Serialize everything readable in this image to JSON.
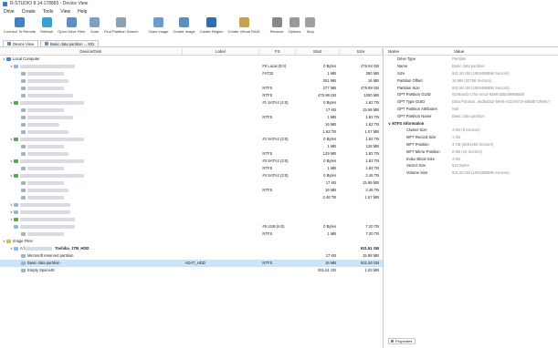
{
  "window": {
    "title": "R-STUDIO 8.14.178865 - Device View"
  },
  "menu": [
    "Drive",
    "Create",
    "Tools",
    "View",
    "Help"
  ],
  "toolbar": [
    {
      "label": "Connect To Remote",
      "icon": "connect-icon",
      "color": "#4a7fc4"
    },
    {
      "label": "Refresh",
      "icon": "refresh-icon",
      "color": "#3aa0d8"
    },
    {
      "label": "Open Drive Files",
      "icon": "open-files-icon",
      "color": "#5a8fcf"
    },
    {
      "label": "Scan",
      "icon": "scan-icon",
      "color": "#7aa2c8"
    },
    {
      "label": "Find Partition Search",
      "icon": "find-partition-icon",
      "color": "#8aa0b8"
    },
    {
      "label": "Open Image",
      "icon": "open-image-icon",
      "color": "#6a9ccf"
    },
    {
      "label": "Create Image",
      "icon": "create-image-icon",
      "color": "#5c8fbf"
    },
    {
      "label": "Create Region",
      "icon": "create-region-icon",
      "color": "#2f6db0"
    },
    {
      "label": "Create Virtual RAID",
      "icon": "virtual-raid-icon",
      "color": "#c7a24a"
    },
    {
      "label": "Remove",
      "icon": "remove-icon",
      "color": "#888888"
    },
    {
      "label": "Options",
      "icon": "options-icon",
      "color": "#9a9a9a"
    },
    {
      "label": "Stop",
      "icon": "stop-icon",
      "color": "#a0a0a0"
    }
  ],
  "tabs": [
    {
      "label": "Device View",
      "active": true
    },
    {
      "label": "Basic data partition ... 931",
      "active": false
    }
  ],
  "columns": {
    "device": "Device/Disk",
    "label": "Label",
    "fs": "FS",
    "start": "Start",
    "size": "Size"
  },
  "rows": [
    {
      "indent": 0,
      "tw": "v",
      "icon": "pc",
      "name": "Local Computer",
      "label": "",
      "fs": "",
      "start": "",
      "size": ""
    },
    {
      "indent": 1,
      "tw": "v",
      "icon": "disk",
      "name": "",
      "blur": 60,
      "label": "",
      "fs": "F0 Local (0:0)",
      "start": "0 Bytes",
      "size": "476.94 GB"
    },
    {
      "indent": 2,
      "tw": "",
      "icon": "part",
      "name": "",
      "blur": 40,
      "label": "",
      "fs": "FAT32",
      "start": "1 MB",
      "size": "260 MB"
    },
    {
      "indent": 2,
      "tw": "",
      "icon": "part",
      "name": "",
      "blur": 45,
      "label": "",
      "fs": "",
      "start": "261 MB",
      "size": "16 MB"
    },
    {
      "indent": 2,
      "tw": "",
      "icon": "part",
      "name": "",
      "blur": 40,
      "label": "",
      "fs": "NTFS",
      "start": "277 MB",
      "size": "475.89 GB"
    },
    {
      "indent": 2,
      "tw": "",
      "icon": "part",
      "name": "",
      "blur": 50,
      "label": "",
      "fs": "NTFS",
      "start": "475.98 GB",
      "size": "1000 MB"
    },
    {
      "indent": 1,
      "tw": "v",
      "icon": "grn",
      "name": "",
      "blur": 70,
      "label": "",
      "fs": "#1 SATA2 (4:0)",
      "start": "0 Bytes",
      "size": "1.82 TB"
    },
    {
      "indent": 2,
      "tw": "",
      "icon": "part",
      "name": "",
      "blur": 40,
      "label": "",
      "fs": "",
      "start": "17 KB",
      "size": "15.98 MB"
    },
    {
      "indent": 2,
      "tw": "",
      "icon": "part",
      "name": "",
      "blur": 50,
      "label": "",
      "fs": "NTFS",
      "start": "1 MB",
      "size": "1.82 TB"
    },
    {
      "indent": 2,
      "tw": "",
      "icon": "part",
      "name": "",
      "blur": 35,
      "label": "",
      "fs": "",
      "start": "16 MB",
      "size": "1.82 TB"
    },
    {
      "indent": 2,
      "tw": "",
      "icon": "part",
      "name": "",
      "blur": 45,
      "label": "",
      "fs": "",
      "start": "1.82 TB",
      "size": "1.07 MB"
    },
    {
      "indent": 1,
      "tw": "v",
      "icon": "grn",
      "name": "",
      "blur": 70,
      "label": "",
      "fs": "#2 SATA2 (3:0)",
      "start": "0 Bytes",
      "size": "1.82 TB"
    },
    {
      "indent": 2,
      "tw": "",
      "icon": "part",
      "name": "",
      "blur": 40,
      "label": "",
      "fs": "",
      "start": "1 MB",
      "size": "128 MB"
    },
    {
      "indent": 2,
      "tw": "",
      "icon": "part",
      "name": "",
      "blur": 45,
      "label": "",
      "fs": "NTFS",
      "start": "129 MB",
      "size": "1.82 TB"
    },
    {
      "indent": 1,
      "tw": "v",
      "icon": "grn",
      "name": "",
      "blur": 70,
      "label": "",
      "fs": "#3 SATA2 (3:0)",
      "start": "0 Bytes",
      "size": "1.82 TB"
    },
    {
      "indent": 2,
      "tw": "",
      "icon": "part",
      "name": "",
      "blur": 40,
      "label": "",
      "fs": "NTFS",
      "start": "1 MB",
      "size": "1.82 TB"
    },
    {
      "indent": 1,
      "tw": "v",
      "icon": "grn",
      "name": "",
      "blur": 70,
      "label": "",
      "fs": "#4 SATA2 (3:0)",
      "start": "0 Bytes",
      "size": "2.46 TB"
    },
    {
      "indent": 2,
      "tw": "",
      "icon": "part",
      "name": "",
      "blur": 40,
      "label": "",
      "fs": "",
      "start": "17 KB",
      "size": "15.98 MB"
    },
    {
      "indent": 2,
      "tw": "",
      "icon": "part",
      "name": "",
      "blur": 45,
      "label": "",
      "fs": "NTFS",
      "start": "16 MB",
      "size": "2.46 TB"
    },
    {
      "indent": 2,
      "tw": "",
      "icon": "part",
      "name": "",
      "blur": 40,
      "label": "",
      "fs": "",
      "start": "2.46 TB",
      "size": "1.57 MB"
    },
    {
      "indent": 1,
      "tw": "v",
      "icon": "disk",
      "name": "",
      "blur": 55,
      "label": "",
      "fs": "",
      "start": "",
      "size": ""
    },
    {
      "indent": 1,
      "tw": "v",
      "icon": "disk",
      "name": "",
      "blur": 55,
      "label": "",
      "fs": "",
      "start": "",
      "size": ""
    },
    {
      "indent": 1,
      "tw": "v",
      "icon": "grn",
      "name": "",
      "blur": 60,
      "label": "",
      "fs": "",
      "start": "",
      "size": ""
    },
    {
      "indent": 1,
      "tw": "",
      "icon": "disk",
      "name": "",
      "blur": 60,
      "label": "",
      "fs": "#5 USB (6:0)",
      "start": "0 Bytes",
      "size": "7.20 TB"
    },
    {
      "indent": 2,
      "tw": "",
      "icon": "part",
      "name": "",
      "blur": 40,
      "label": "",
      "fs": "NTFS",
      "start": "1 MB",
      "size": "7.20 TB"
    },
    {
      "indent": 0,
      "tw": "v",
      "icon": "img",
      "name": "Image Files",
      "label": "",
      "fs": "",
      "start": "",
      "size": ""
    },
    {
      "indent": 1,
      "tw": "v",
      "icon": "disk",
      "name": "Toshiba_1TB_HDD",
      "prefix": "A:\\",
      "blur": 30,
      "label": "",
      "fs": "",
      "start": "",
      "size": "931.51 GB",
      "bold": true
    },
    {
      "indent": 2,
      "tw": "",
      "icon": "part",
      "name": "Microsoft reserved partition",
      "label": "",
      "fs": "",
      "start": "17 KB",
      "size": "15.98 MB"
    },
    {
      "indent": 2,
      "tw": "",
      "icon": "part",
      "name": "Basic data partition",
      "label": "ADAT_HDD",
      "fs": "NTFS",
      "start": "16 MB",
      "size": "931.50 GB",
      "selected": true
    },
    {
      "indent": 2,
      "tw": "",
      "icon": "part",
      "name": "Empty Space46",
      "label": "",
      "fs": "",
      "start": "931.51 GB",
      "size": "1.03 MB"
    }
  ],
  "props_header": {
    "name": "Name",
    "value": "Value"
  },
  "properties": [
    {
      "name": "Drive Type",
      "value": "Partition"
    },
    {
      "name": "Name",
      "value": "Basic data partition"
    },
    {
      "name": "Size",
      "value": "931.50 GB (1953488896 Sectors)"
    },
    {
      "name": "Partition Offset",
      "value": "16 MB (32768 Sectors)"
    },
    {
      "name": "Partition Size",
      "value": "931.50 GB (1953488896 Sectors)"
    },
    {
      "name": "GPT Partition GUID",
      "value": "9106a4cb-c75c-4e1d-9398-bd5c898089d0"
    },
    {
      "name": "GPT Type GUID",
      "value": "Data Partition, ebd0a0a2-b9e5-4433-87c0-68b6b72699c7"
    },
    {
      "name": "GPT Partition Attributes",
      "value": "Null"
    },
    {
      "name": "GPT Partition Name",
      "value": "Basic data partition"
    },
    {
      "name": "NTFS Information",
      "value": "",
      "group": true
    },
    {
      "name": "Cluster Size",
      "value": "4 KB (8 Sectors)",
      "sub": true
    },
    {
      "name": "MFT Record Size",
      "value": "1 KB",
      "sub": true
    },
    {
      "name": "MFT Position",
      "value": "3 GB (6291456 Sectors)",
      "sub": true
    },
    {
      "name": "MFT Mirror Position",
      "value": "8 KB (16 Sectors)",
      "sub": true
    },
    {
      "name": "Index Block Size",
      "value": "4 KB",
      "sub": true
    },
    {
      "name": "Sector Size",
      "value": "512 Bytes",
      "sub": true
    },
    {
      "name": "Volume Size",
      "value": "931.50 GB (1953488895 Sectors)",
      "sub": true
    }
  ],
  "footer_tab": "Properties"
}
